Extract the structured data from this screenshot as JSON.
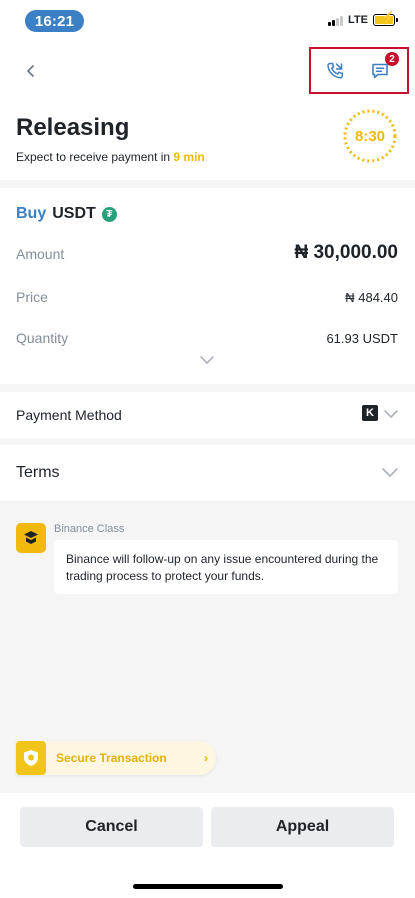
{
  "status_bar": {
    "time": "16:21",
    "network": "LTE"
  },
  "header": {
    "notification_count": "2",
    "title": "Releasing",
    "subtitle_prefix": "Expect to receive payment in ",
    "subtitle_highlight": "9 min",
    "timer": "8:30"
  },
  "order": {
    "side": "Buy",
    "asset": "USDT",
    "asset_icon_glyph": "₮",
    "rows": [
      {
        "label": "Amount",
        "value": "₦ 30,000.00"
      },
      {
        "label": "Price",
        "value": "₦ 484.40"
      },
      {
        "label": "Quantity",
        "value": "61.93 USDT"
      }
    ]
  },
  "payment": {
    "label": "Payment Method",
    "bank_logo_letter": "K"
  },
  "terms": {
    "label": "Terms"
  },
  "chat": {
    "sender": "Binance Class",
    "message": "Binance will follow-up on any issue encountered during the trading process to protect your funds."
  },
  "secure": {
    "label": "Secure Transaction",
    "arrow": "›"
  },
  "actions": {
    "cancel": "Cancel",
    "appeal": "Appeal"
  },
  "colors": {
    "brand_yellow": "#f0b90b",
    "buy_blue": "#3b7fc4",
    "badge_red": "#c8102e",
    "highlight_box": "#c8102e"
  },
  "icons": [
    "back-arrow-icon",
    "phone-call-icon",
    "chat-icon",
    "timer-icon",
    "tether-icon",
    "chevron-down-icon",
    "bank-logo-icon",
    "binance-class-icon",
    "shield-icon"
  ]
}
